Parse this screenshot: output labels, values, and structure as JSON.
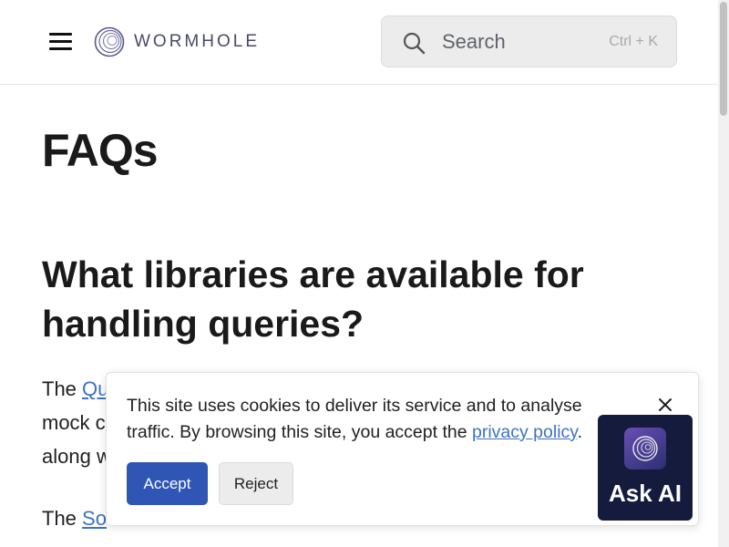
{
  "header": {
    "logo_text": "WORMHOLE",
    "search": {
      "placeholder": "Search",
      "shortcut": "Ctrl + K"
    }
  },
  "main": {
    "title": "FAQs",
    "question": "What libraries are available for handling queries?",
    "para1_lines": [
      {
        "before": "The ",
        "link": "Qu",
        "after": ""
      },
      {
        "before": "mock c",
        "link": "",
        "after": ""
      },
      {
        "before": "along w",
        "link": "",
        "after": ""
      }
    ],
    "para2": {
      "before": "The ",
      "link": "So",
      "after": ""
    },
    "para3": {
      "text": ""
    }
  },
  "cookie_banner": {
    "text_line1": "This site uses cookies to deliver its service and to analyse",
    "text_line2_before": "traffic. By browsing this site, you accept the ",
    "privacy_link": "privacy policy",
    "text_line2_after": ".",
    "accept_label": "Accept",
    "reject_label": "Reject"
  },
  "ask_ai": {
    "label": "Ask AI"
  },
  "colors": {
    "accent": "#2f55b5",
    "link": "#3d72c4",
    "ask_ai_bg": "#151b3c"
  },
  "icons": [
    "menu-icon",
    "wormhole-logo-icon",
    "search-icon",
    "close-icon",
    "ask-ai-icon"
  ]
}
